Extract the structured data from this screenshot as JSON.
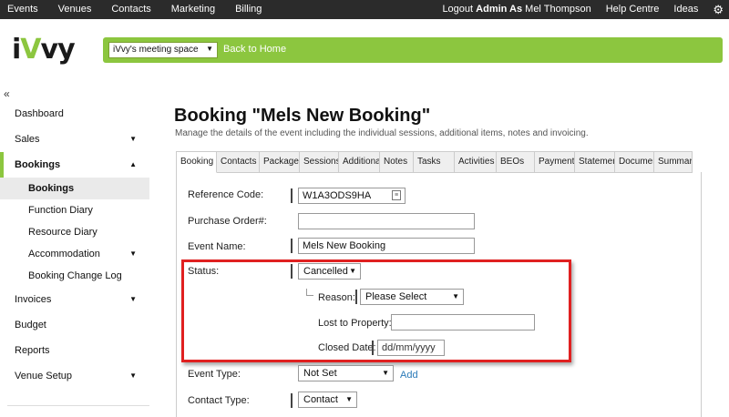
{
  "topbar": {
    "nav": [
      "Events",
      "Venues",
      "Contacts",
      "Marketing",
      "Billing"
    ],
    "logout": "Logout",
    "admin_as": "Admin As",
    "user": "Mel Thompson",
    "help": "Help Centre",
    "ideas": "Ideas",
    "gear_icon": "gear-icon"
  },
  "header": {
    "logo_text": "iVvy",
    "venue_select": "iVvy's meeting space",
    "back_home": "Back to Home",
    "accent_color": "#8cc63f"
  },
  "sidebar": {
    "collapse": "«",
    "items": [
      {
        "label": "Dashboard"
      },
      {
        "label": "Sales"
      },
      {
        "label": "Bookings"
      },
      {
        "label": "Invoices"
      },
      {
        "label": "Budget"
      },
      {
        "label": "Reports"
      },
      {
        "label": "Venue Setup"
      }
    ],
    "sub_items": [
      {
        "label": "Bookings"
      },
      {
        "label": "Function Diary"
      },
      {
        "label": "Resource Diary"
      },
      {
        "label": "Accommodation"
      },
      {
        "label": "Booking Change Log"
      }
    ]
  },
  "main": {
    "title": "Booking \"Mels New Booking\"",
    "subtitle": "Manage the details of the event including the individual sessions, additional items, notes and invoicing.",
    "tabs": [
      "Booking",
      "Contacts",
      "Package",
      "Sessions",
      "Additional",
      "Notes",
      "Tasks",
      "Activities",
      "BEOs",
      "Payments",
      "Statements",
      "Documents",
      "Summary"
    ],
    "form": {
      "reference_label": "Reference Code:",
      "reference_value": "W1A3ODS9HA",
      "purchase_label": "Purchase Order#:",
      "purchase_value": "",
      "event_name_label": "Event Name:",
      "event_name_value": "Mels New Booking",
      "status_label": "Status:",
      "status_value": "Cancelled",
      "reason_label": "Reason:",
      "reason_value": "Please Select",
      "lost_label": "Lost to Property:",
      "lost_value": "",
      "closed_label": "Closed Date:",
      "closed_placeholder": "dd/mm/yyyy",
      "event_type_label": "Event Type:",
      "event_type_value": "Not Set",
      "add_link": "Add",
      "contact_type_label": "Contact Type:",
      "contact_type_value": "Contact"
    },
    "highlight_color": "#e02020"
  }
}
